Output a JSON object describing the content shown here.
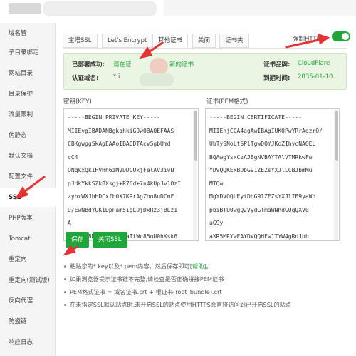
{
  "sidebar": {
    "items": [
      {
        "label": "域名管"
      },
      {
        "label": "子目录绑定"
      },
      {
        "label": "网站目录"
      },
      {
        "label": "目录保护"
      },
      {
        "label": "流量限制"
      },
      {
        "label": "伪静态"
      },
      {
        "label": "默认文档"
      },
      {
        "label": "配置文件"
      },
      {
        "label": "SSL"
      },
      {
        "label": "PHP版本"
      },
      {
        "label": "Tomcat"
      },
      {
        "label": "重定向"
      },
      {
        "label": "重定向(测试版)"
      },
      {
        "label": "反向代理"
      },
      {
        "label": "防盗链"
      },
      {
        "label": "响应日志"
      }
    ],
    "active_index": 8
  },
  "tabs": [
    {
      "label": "宝塔SSL"
    },
    {
      "label": "Let's Encrypt"
    },
    {
      "label": "其他证书"
    },
    {
      "label": "关闭"
    },
    {
      "label": "证书夹"
    }
  ],
  "active_tab": 2,
  "force_https": {
    "label": "强制HTTPS",
    "enabled": true
  },
  "cert_info": {
    "deployed_label": "已部署成功:",
    "deployed_value_a": "请在证",
    "deployed_value_b": "新的证书",
    "domains_label": "认证域名:",
    "domains_value": "*.i",
    "brand_label": "证书品牌:",
    "brand_value": "CloudFlare",
    "expiry_label": "到期时间:",
    "expiry_value": "2035-01-10"
  },
  "key_field": {
    "label": "密钥(KEY)",
    "lines": [
      "-----BEGIN PRIVATE KEY-----",
      "MIIEvgIBADANBgkqhkiG9w0BAQEFAAS",
      "CBKgwggSkAgEAAoIBAQDTAcvSgbUmd",
      "cC4",
      "ONqkxQkIHVHh6zMVDDCUxjFelAV3ivN",
      "pJdkYkkSZkBXsgj+R76d+7n4kUpJv1OzI",
      "zyhxWXJbHDCxfb0X7KRrAgZhn8uDCmF",
      "D/EwNBdYUK1DpPam5igLDjDxRz3jBLz1",
      "A",
      "64HqqG8Mjt332VG2xaTtWc85oU0hKsk6"
    ]
  },
  "cert_field": {
    "label": "证书(PEM格式)",
    "lines": [
      "-----BEGIN CERTIFICATE-----",
      "MIIEnjCCA4agAwIBAgIUK0PwYRrAozrO/",
      "UbTySNoLtSPlTgwDQYJKoZIhvcNAQEL",
      "BQAwgYsxCzAJBgNVBAYTAlVTMRkwFw",
      "YDVQQKExBDbG91ZEZsYXJlLCBJbmMu",
      "MTQw",
      "MgYDVQQLEytDbG91ZEZsYXJlIE9yaWd",
      "pbiBTU0wgQ2VydGlmaWNhdGUgQXV0",
      "aG9y",
      "aXR5MRYwFAYDVQQHEw1TYW4gRnJhb"
    ]
  },
  "buttons": {
    "save": "保存",
    "close_ssl": "关闭SSL"
  },
  "tips": [
    {
      "text": "粘贴您的*.key以及*.pem内容，然后保存即可",
      "help": "[帮助]",
      "tail": "。"
    },
    {
      "text": "如果浏览器提示证书链不完整,请检查是否正确拼接PEM证书",
      "help": "",
      "tail": ""
    },
    {
      "text": "PEM格式证书 = 域名证书.crt + 根证书(root_bundle).crt",
      "help": "",
      "tail": ""
    },
    {
      "text": "在未指定SSL默认站点时,未开启SSL的站点使用HTTPS会直接访问到已开启SSL的站点",
      "help": "",
      "tail": ""
    }
  ],
  "colors": {
    "accent": "#20a53a",
    "annotation": "#e53333"
  }
}
